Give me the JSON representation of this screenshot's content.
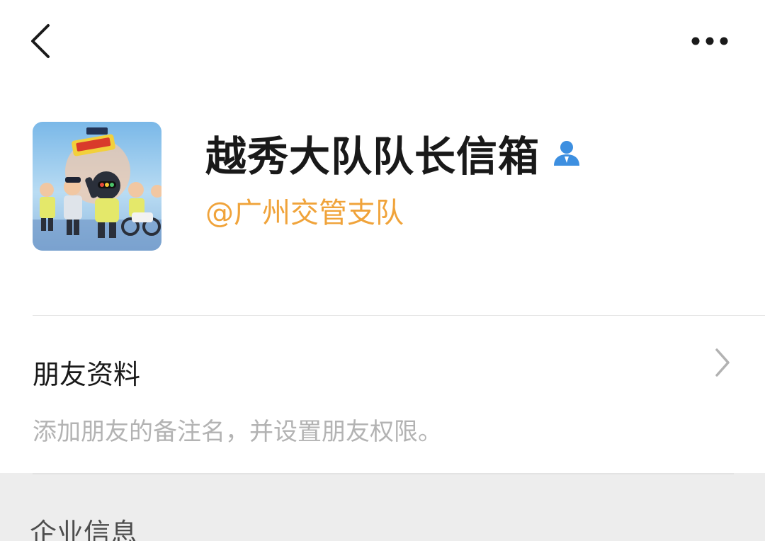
{
  "nav": {
    "back_icon": "chevron-left-icon",
    "more_icon": "more-dots-icon"
  },
  "profile": {
    "name": "越秀大队队长信箱",
    "verified_icon": "person-verified-icon",
    "verified_color": "#3d8fe0",
    "handle": "@广州交管支队",
    "handle_color": "#f0a33a",
    "avatar_icon": "cartoon-traffic-police-avatar"
  },
  "friend_info": {
    "title": "朋友资料",
    "description": "添加朋友的备注名，并设置朋友权限。",
    "chevron_icon": "chevron-right-icon"
  },
  "enterprise": {
    "label": "企业信息"
  }
}
